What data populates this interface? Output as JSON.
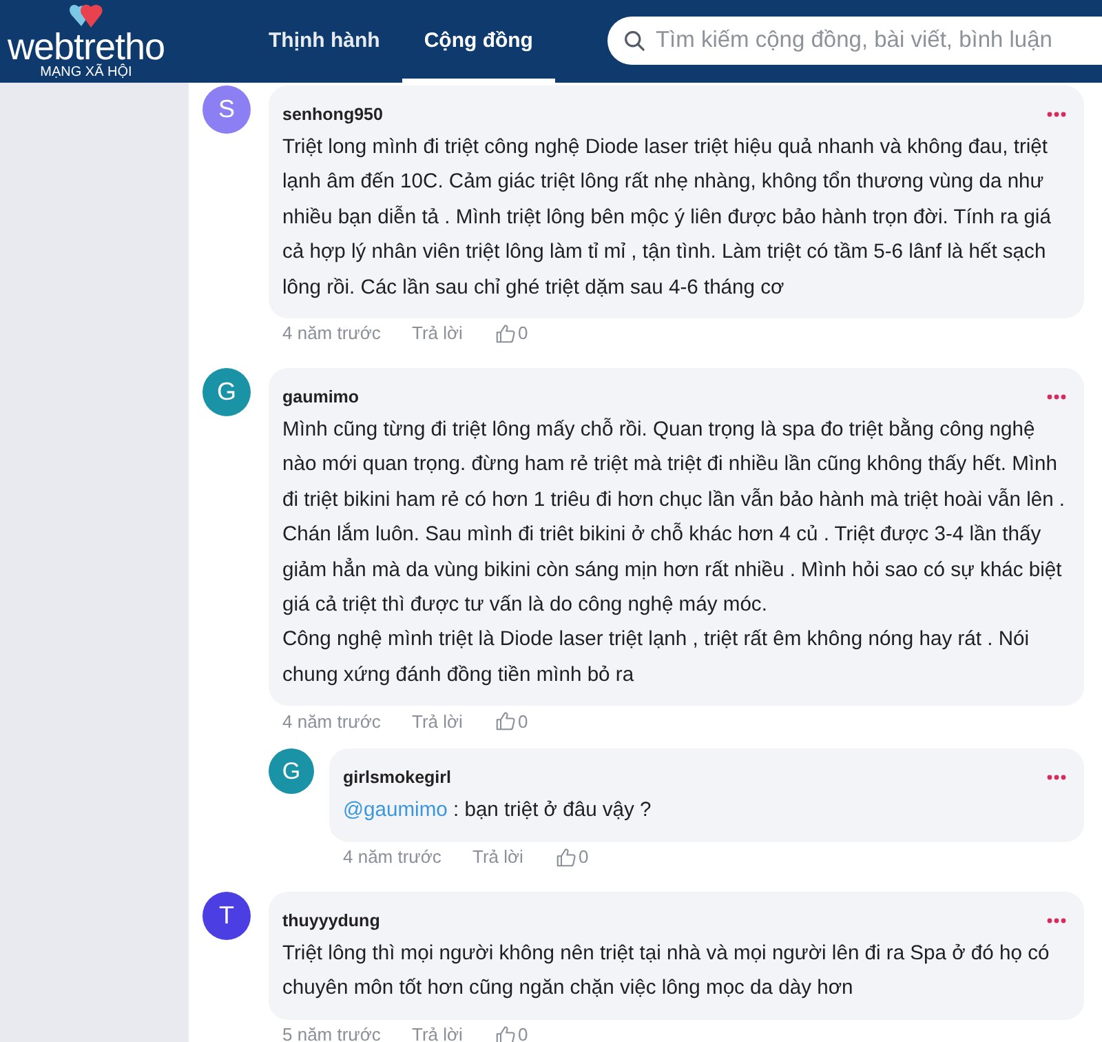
{
  "header": {
    "logo": {
      "wordmark": "webtretho",
      "tagline": "MẠNG XÃ HỘI"
    },
    "tabs": [
      {
        "label": "Thịnh hành",
        "selected": false
      },
      {
        "label": "Cộng đồng",
        "selected": true
      }
    ],
    "search": {
      "placeholder": "Tìm kiếm cộng đồng, bài viết, bình luận"
    }
  },
  "comments": [
    {
      "avatar_letter": "S",
      "color": "#8b7ff3",
      "username": "senhong950",
      "paragraphs": [
        "Triệt long mình đi triệt công nghệ Diode laser triệt hiệu quả nhanh và không đau, triệt lạnh âm đến 10C. Cảm giác triệt lông rất nhẹ nhàng, không tổn thương vùng da như nhiều bạn diễn tả . Mình triệt lông bên mộc ý liên được bảo hành trọn đời. Tính ra giá cả hợp lý nhân viên triệt lông làm tỉ mỉ , tận tình. Làm triệt có tầm 5-6 lânf là hết sạch lông rồi. Các lần sau chỉ ghé triệt dặm sau 4-6 tháng cơ"
      ],
      "time": "4 năm trước",
      "reply_label": "Trả lời",
      "likes": "0"
    },
    {
      "avatar_letter": "G",
      "color": "#1a93a7",
      "username": "gaumimo",
      "paragraphs": [
        "Mình cũng từng đi triệt lông mấy chỗ rồi. Quan trọng là spa đo triệt bằng công nghệ nào mới quan trọng. đừng ham rẻ triệt mà triệt đi nhiều lần cũng không thấy hết. Mình đi triệt bikini ham rẻ có hơn 1 triêu đi hơn chục lần vẫn bảo hành mà triệt hoài vẫn lên . Chán lắm luôn. Sau mình đi triêt bikini ở chỗ khác hơn 4 củ . Triệt được 3-4 lần thấy giảm hẳn mà da vùng bikini còn sáng mịn hơn rất nhiều . Mình hỏi sao có sự khác biệt giá cả triệt thì được tư vấn là do công nghệ máy móc.",
        "Công nghệ mình triệt là Diode laser triệt lạnh , triệt rất êm không nóng hay rát . Nói chung xứng đánh đồng tiền mình bỏ ra"
      ],
      "time": "4 năm trước",
      "reply_label": "Trả lời",
      "likes": "0",
      "replies": [
        {
          "avatar_letter": "G",
          "color": "#1a93a7",
          "username": "girlsmokegirl",
          "mention": "@gaumimo",
          "paragraphs": [
            " : bạn triệt ở đâu vậy ?"
          ],
          "time": "4 năm trước",
          "reply_label": "Trả lời",
          "likes": "0"
        }
      ]
    },
    {
      "avatar_letter": "T",
      "color": "#4b3fe3",
      "username": "thuyyydung",
      "paragraphs": [
        "Triệt lông thì mọi người không nên triệt tại nhà và mọi người lên đi ra Spa ở đó họ có chuyên môn tốt hơn cũng ngăn chặn việc lông mọc da dày hơn"
      ],
      "time": "5 năm trước",
      "reply_label": "Trả lời",
      "likes": "0"
    }
  ]
}
